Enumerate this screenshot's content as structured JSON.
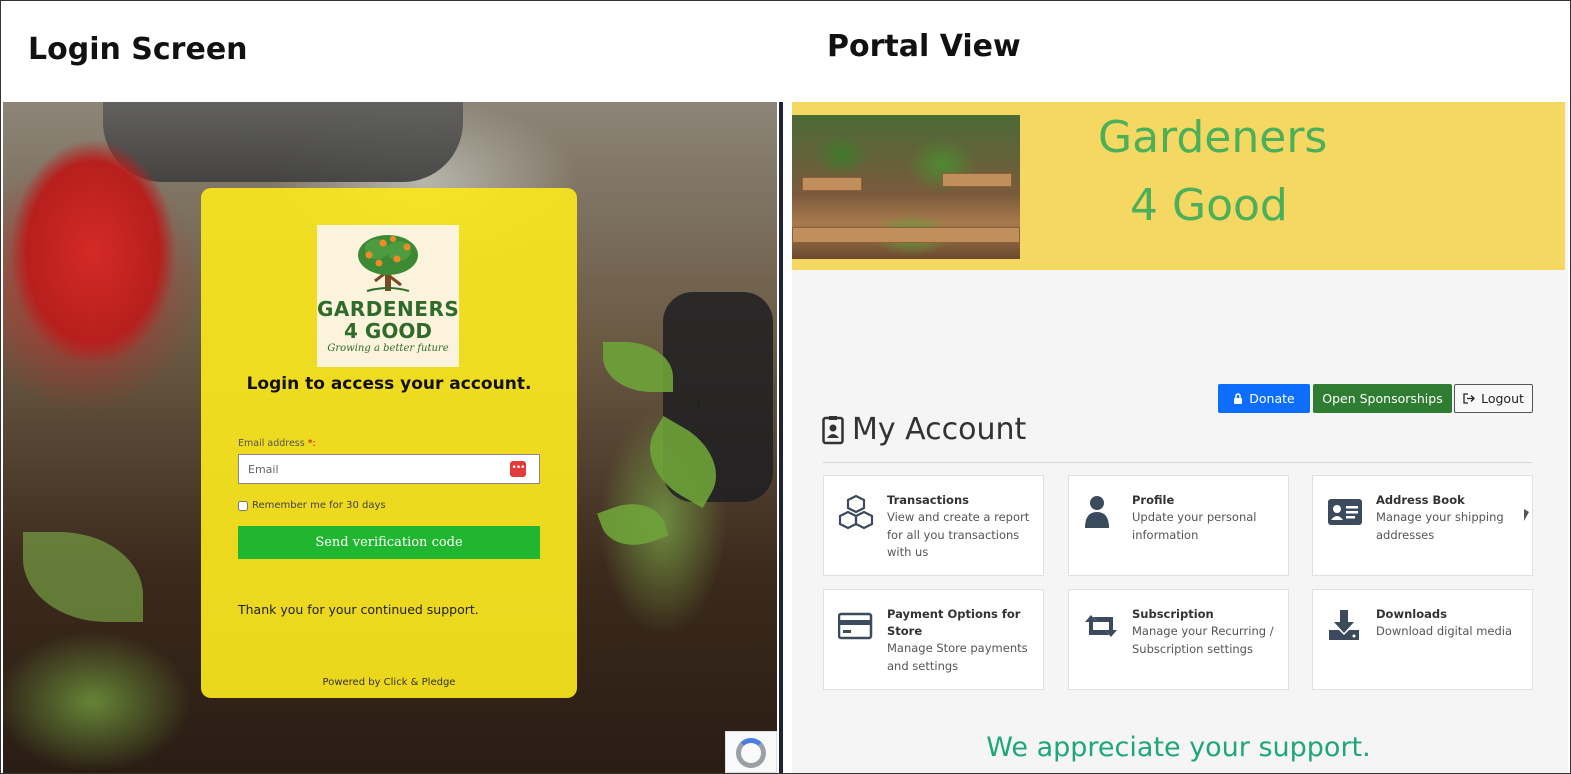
{
  "headings": {
    "login": "Login Screen",
    "portal": "Portal View"
  },
  "login": {
    "logo_line1": "GARDENERS",
    "logo_line2": "4 GOOD",
    "logo_tagline": "Growing a better future",
    "title": "Login to access your account.",
    "email_label": "Email address",
    "email_required_mark": "*:",
    "email_placeholder": "Email",
    "remember_label": "Remember me for 30 days",
    "send_button": "Send verification code",
    "thanks": "Thank you for your continued support.",
    "powered_by": "Powered by Click & Pledge"
  },
  "portal": {
    "banner_line1": "Gardeners",
    "banner_line2": "4 Good",
    "donate_button": "Donate",
    "sponsorships_button": "Open Sponsorships",
    "logout_button": "Logout",
    "account_title": "My Account",
    "tiles": [
      {
        "title": "Transactions",
        "desc": "View and create a report for all you transactions with us",
        "icon": "cubes-icon"
      },
      {
        "title": "Profile",
        "desc": "Update your personal information",
        "icon": "user-icon"
      },
      {
        "title": "Address Book",
        "desc": "Manage your shipping addresses",
        "icon": "address-card-icon"
      },
      {
        "title": "Payment Options for Store",
        "desc": "Manage Store payments and settings",
        "icon": "credit-card-icon"
      },
      {
        "title": "Subscription",
        "desc": "Manage your Recurring / Subscription settings",
        "icon": "retweet-icon"
      },
      {
        "title": "Downloads",
        "desc": "Download digital media",
        "icon": "download-icon"
      }
    ],
    "appreciate": "We appreciate your support."
  },
  "colors": {
    "login_card": "#fae61e",
    "send_button": "#20b630",
    "banner": "#f5d862",
    "brand_green": "#4caf5a",
    "donate": "#0d6efd",
    "sponsorships": "#2e7d32",
    "appreciate": "#1fa67a"
  }
}
